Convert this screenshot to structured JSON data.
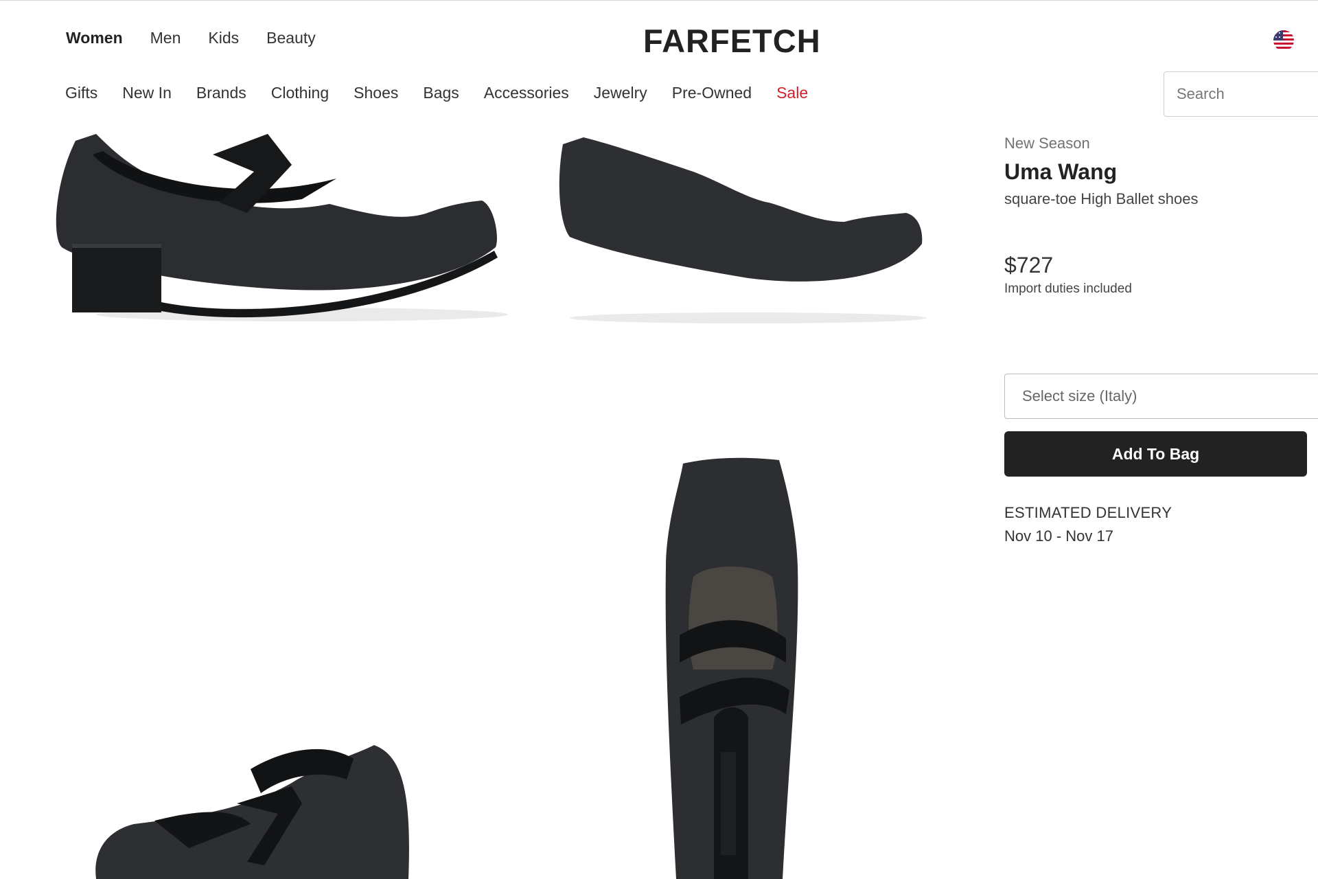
{
  "header": {
    "departments": [
      {
        "label": "Women",
        "active": true
      },
      {
        "label": "Men",
        "active": false
      },
      {
        "label": "Kids",
        "active": false
      },
      {
        "label": "Beauty",
        "active": false
      }
    ],
    "logo": "FARFETCH",
    "flag_icon": "us-flag-icon",
    "categories": [
      {
        "label": "Gifts"
      },
      {
        "label": "New In"
      },
      {
        "label": "Brands"
      },
      {
        "label": "Clothing"
      },
      {
        "label": "Shoes"
      },
      {
        "label": "Bags"
      },
      {
        "label": "Accessories"
      },
      {
        "label": "Jewelry"
      },
      {
        "label": "Pre-Owned"
      },
      {
        "label": "Sale"
      }
    ],
    "search": {
      "placeholder": "Search",
      "value": ""
    }
  },
  "product": {
    "season": "New Season",
    "brand": "Uma Wang",
    "name": "square-toe High Ballet shoes",
    "price": "$727",
    "duties": "Import duties included",
    "size_select": "Select size (Italy)",
    "add_to_bag": "Add To Bag",
    "delivery_label": "ESTIMATED DELIVERY",
    "delivery_dates": "Nov 10 - Nov 17"
  },
  "colors": {
    "sale": "#d0212b",
    "button_bg": "#222222",
    "shoe": "#2b2d30"
  }
}
